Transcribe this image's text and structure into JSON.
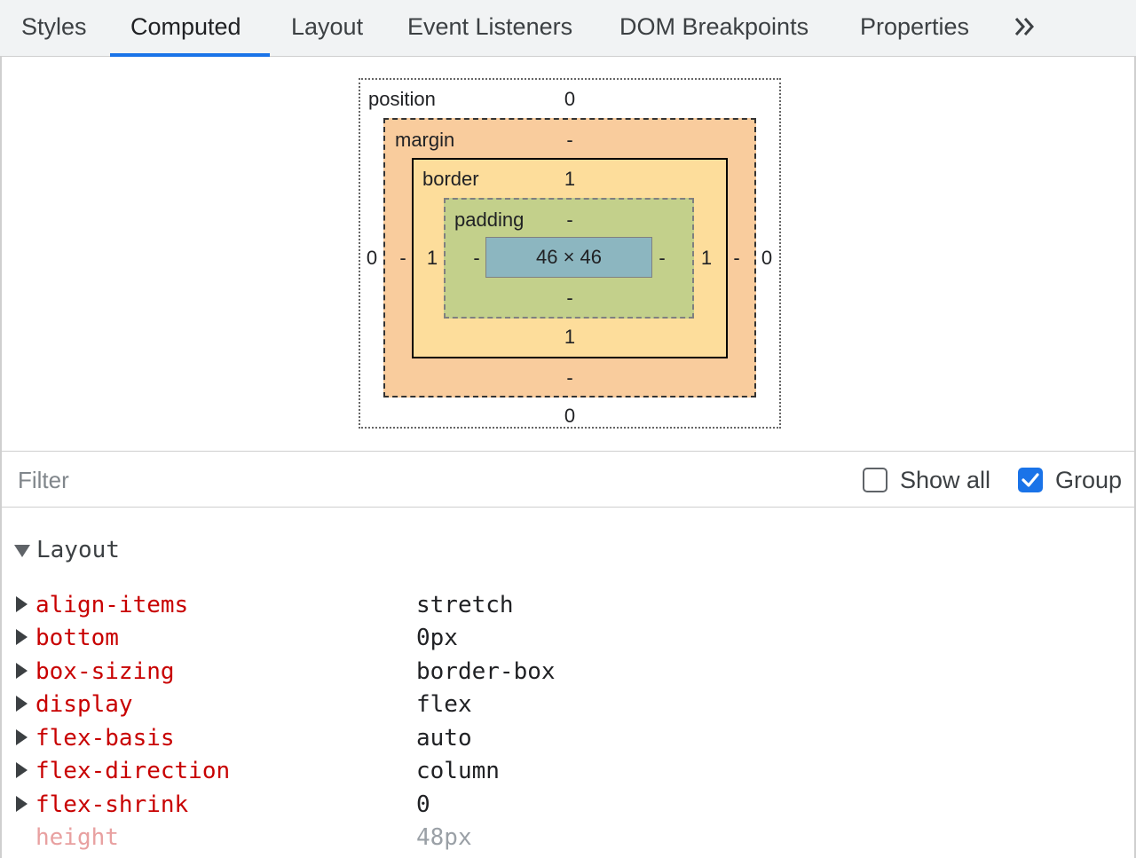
{
  "tabs": [
    {
      "label": "Styles"
    },
    {
      "label": "Computed"
    },
    {
      "label": "Layout"
    },
    {
      "label": "Event Listeners"
    },
    {
      "label": "DOM Breakpoints"
    },
    {
      "label": "Properties"
    }
  ],
  "active_tab": "Computed",
  "more_tabs_icon": "chevron-double-right-icon",
  "box_model": {
    "position": {
      "label": "position",
      "top": "0",
      "right": "0",
      "bottom": "0",
      "left": "0"
    },
    "margin": {
      "label": "margin",
      "top": "-",
      "right": "-",
      "bottom": "-",
      "left": "-"
    },
    "border": {
      "label": "border",
      "top": "1",
      "right": "1",
      "bottom": "1",
      "left": "1"
    },
    "padding": {
      "label": "padding",
      "top": "-",
      "right": "-",
      "bottom": "-",
      "left": "-"
    },
    "content": "46 × 46",
    "colors": {
      "margin": "#f9cc9d",
      "border": "#fddd9b",
      "padding": "#c3d08b",
      "content": "#8cb6c0"
    }
  },
  "filter": {
    "placeholder": "Filter",
    "value": ""
  },
  "show_all": {
    "label": "Show all",
    "checked": false
  },
  "group": {
    "label": "Group",
    "checked": true
  },
  "computed": {
    "group_title": "Layout",
    "properties": [
      {
        "name": "align-items",
        "value": "stretch",
        "expandable": true
      },
      {
        "name": "bottom",
        "value": "0px",
        "expandable": true
      },
      {
        "name": "box-sizing",
        "value": "border-box",
        "expandable": true
      },
      {
        "name": "display",
        "value": "flex",
        "expandable": true
      },
      {
        "name": "flex-basis",
        "value": "auto",
        "expandable": true
      },
      {
        "name": "flex-direction",
        "value": "column",
        "expandable": true
      },
      {
        "name": "flex-shrink",
        "value": "0",
        "expandable": true
      },
      {
        "name": "height",
        "value": "48px",
        "expandable": false
      }
    ]
  },
  "colors": {
    "accent": "#1a73e8",
    "property_name": "#c80000"
  }
}
